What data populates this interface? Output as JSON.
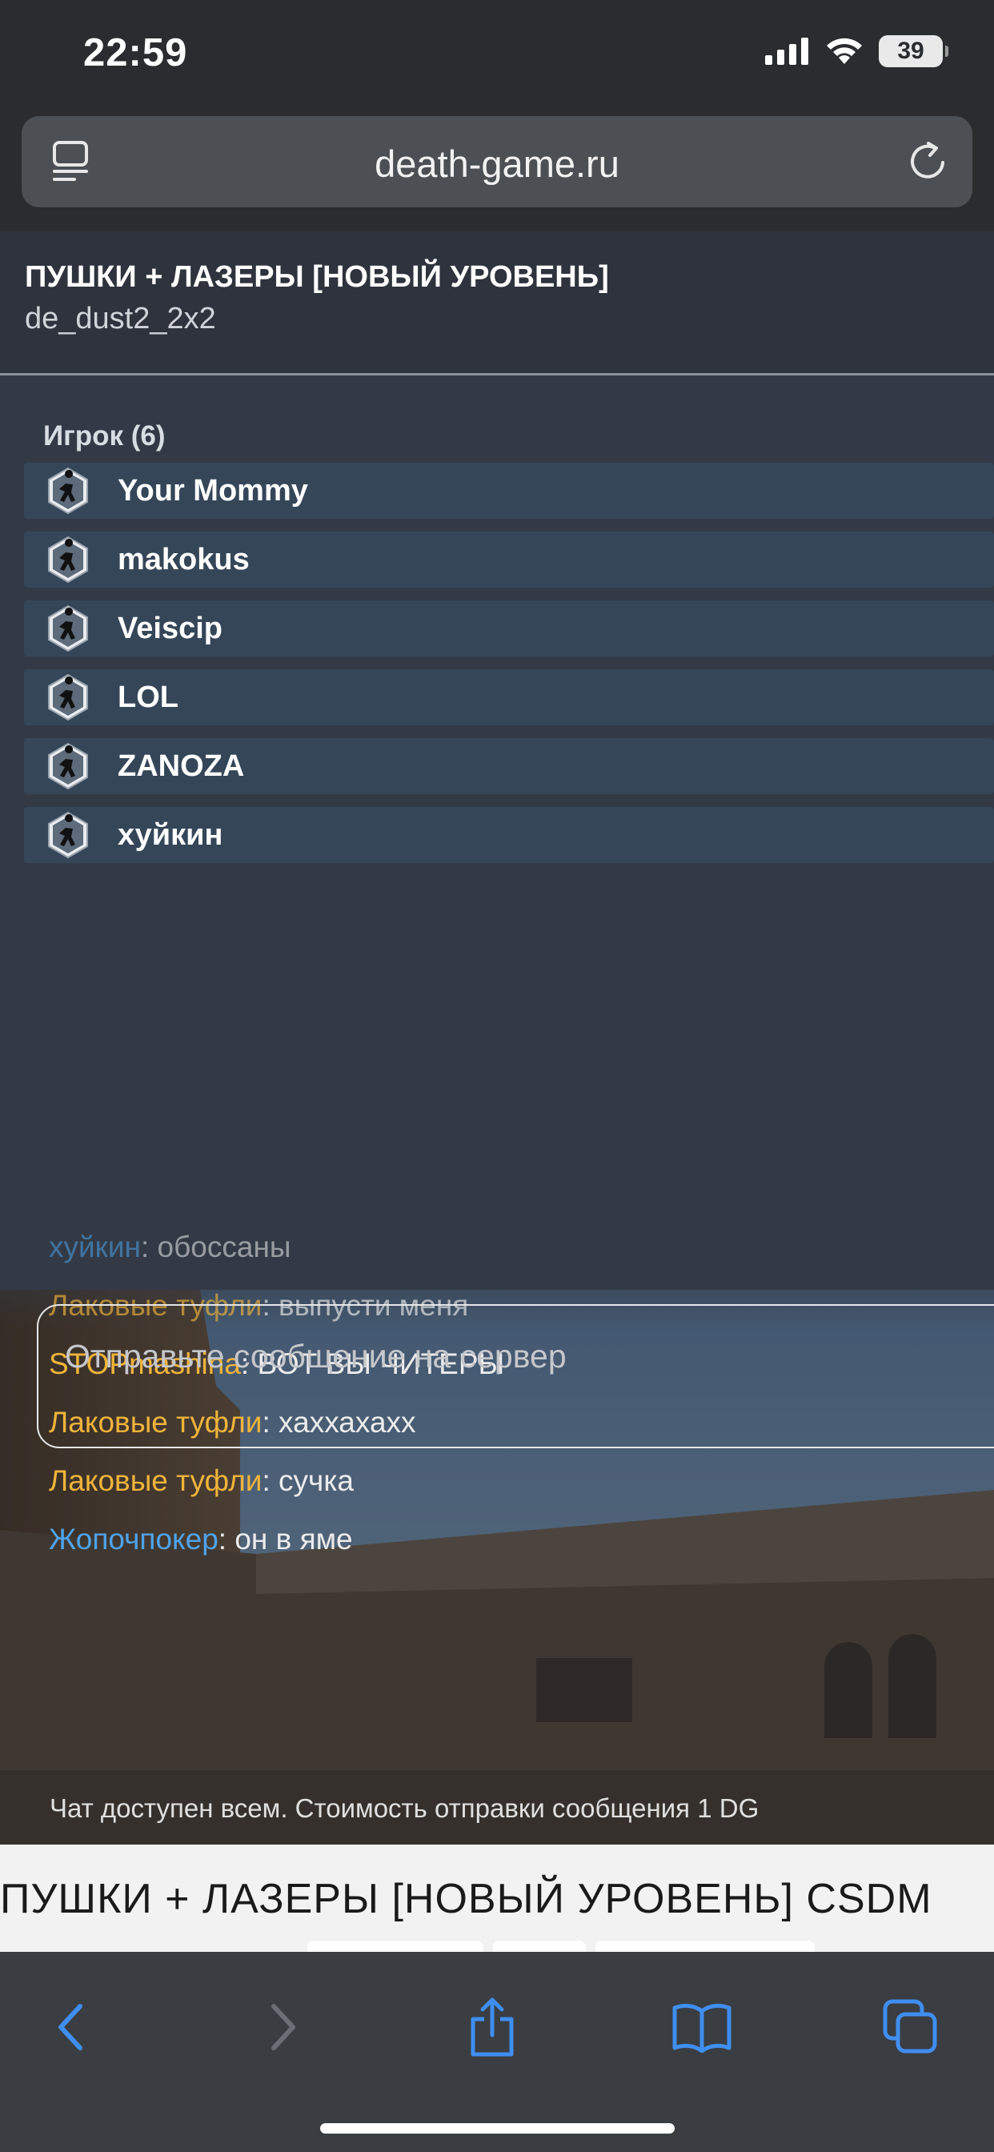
{
  "status_bar": {
    "time": "22:59",
    "battery": "39"
  },
  "browser": {
    "url": "death-game.ru"
  },
  "server": {
    "name": "ПУШКИ + ЛАЗЕРЫ [НОВЫЙ УРОВЕНЬ]",
    "map": "de_dust2_2x2"
  },
  "players": {
    "header": "Игрок (6)",
    "list": [
      "Your Mommy",
      "makokus",
      "Veiscip",
      "LOL",
      "ZANOZA",
      "хуйкин"
    ]
  },
  "chat": {
    "messages": [
      {
        "nick": "хуйкин",
        "sep": ": ",
        "text": "обоссаны"
      },
      {
        "nick": "Лаковые туфли",
        "sep": ": ",
        "text": "выпусти меня"
      },
      {
        "nick": "STOPmashina",
        "sep": ": ",
        "text": "ВОТ ВЫ ЧИТЕРЫ"
      },
      {
        "nick": "Лаковые туфли",
        "sep": ": ",
        "text": "хаххахахх"
      },
      {
        "nick": "Лаковые туфли",
        "sep": ": ",
        "text": "сучка"
      },
      {
        "nick": "Жопочпокер",
        "sep": ": ",
        "text": "он в яме"
      }
    ],
    "placeholder": "Отправьте сообщение на сервер",
    "note": "Чат доступен всем. Стоимость отправки сообщения 1 DG"
  },
  "page": {
    "title": "ПУШКИ + ЛАЗЕРЫ [НОВЫЙ УРОВЕНЬ] CSDM"
  },
  "colors": {
    "nick_orange": "#f0b43a",
    "nick_blue": "#4ea3ea",
    "accent": "#3f8ef0"
  },
  "toolbar_icons": [
    "back-icon",
    "forward-icon",
    "share-icon",
    "bookmarks-icon",
    "tabs-icon"
  ]
}
